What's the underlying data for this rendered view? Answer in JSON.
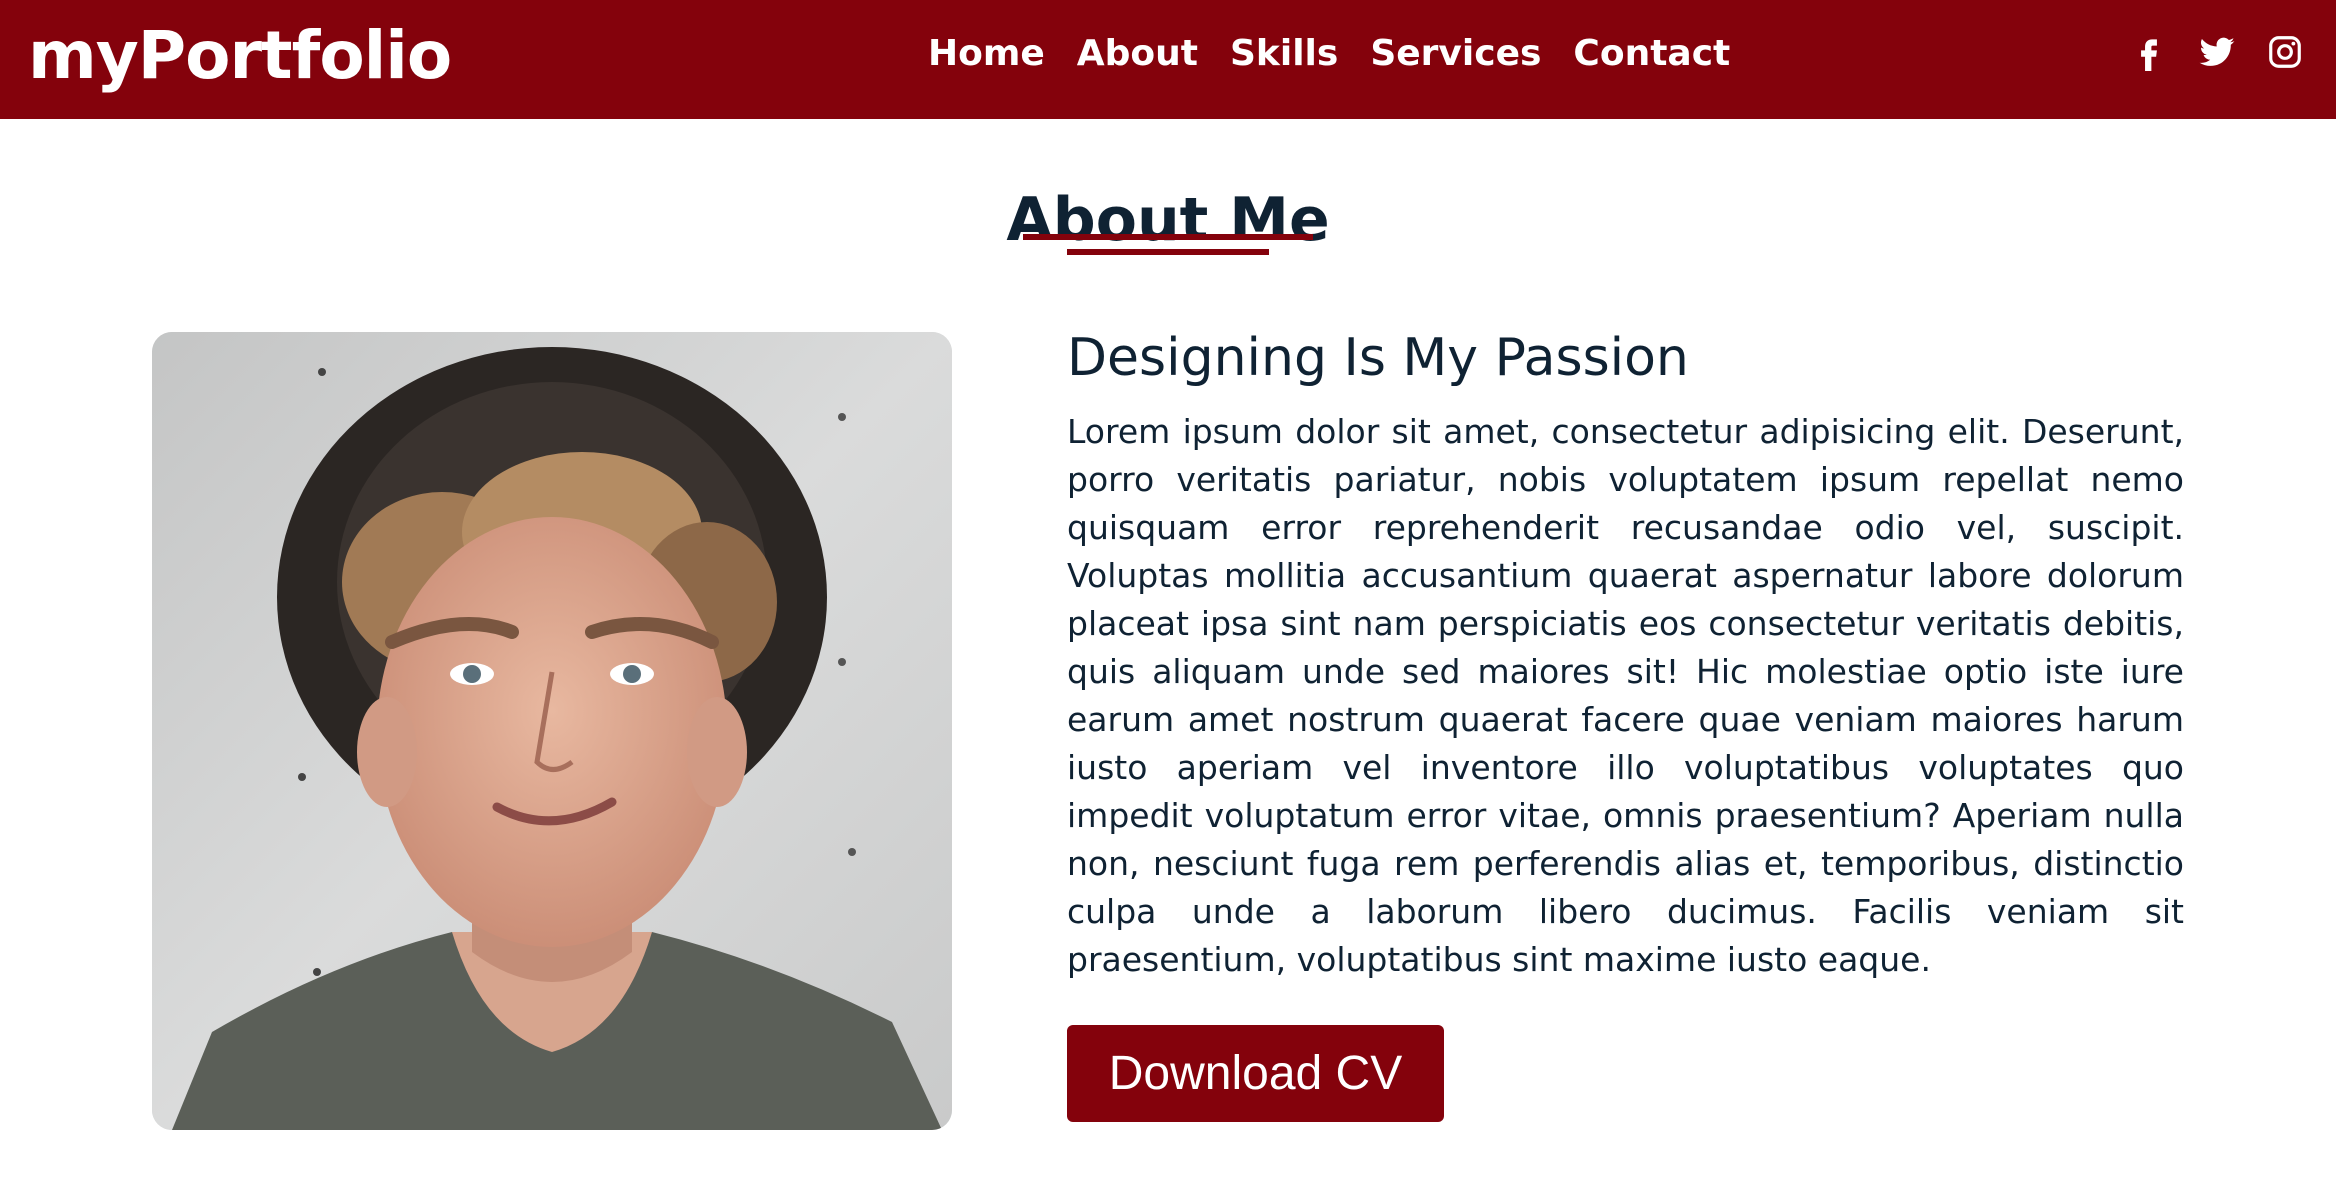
{
  "brand": "myPortfolio",
  "nav": {
    "items": [
      {
        "label": "Home"
      },
      {
        "label": "About"
      },
      {
        "label": "Skills"
      },
      {
        "label": "Services"
      },
      {
        "label": "Contact"
      }
    ],
    "socials": [
      "facebook-icon",
      "twitter-icon",
      "instagram-icon"
    ]
  },
  "about": {
    "title": "About Me",
    "subtitle": "Designing Is My Passion",
    "paragraph": "Lorem ipsum dolor sit amet, consectetur adipisicing elit. Deserunt, porro veritatis pariatur, nobis voluptatem ipsum repellat nemo quisquam error reprehenderit recusandae odio vel, suscipit. Voluptas mollitia accusantium quaerat aspernatur labore dolorum placeat ipsa sint nam perspiciatis eos consectetur veritatis debitis, quis aliquam unde sed maiores sit! Hic molestiae optio iste iure earum amet nostrum quaerat facere quae veniam maiores harum iusto aperiam vel inventore illo voluptatibus voluptates quo impedit voluptatum error vitae, omnis praesentium? Aperiam nulla non, nesciunt fuga rem perferendis alias et, temporibus, distinctio culpa unde a laborum libero ducimus. Facilis veniam sit praesentium, voluptatibus sint maxime iusto eaque.",
    "button_label": "Download CV",
    "photo_icon": "profile-photo"
  },
  "colors": {
    "accent": "#84020c",
    "heading": "#0f2233",
    "background": "#ffffff"
  }
}
